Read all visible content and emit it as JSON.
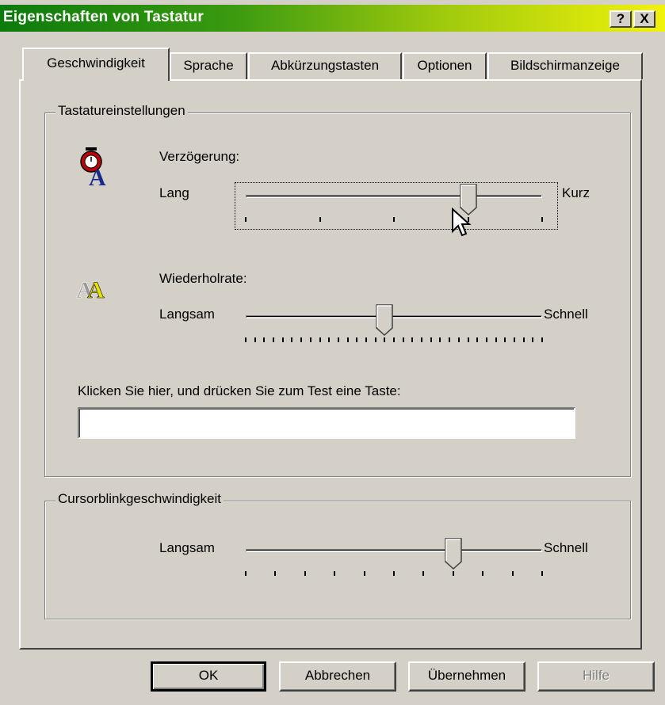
{
  "window": {
    "title": "Eigenschaften von Tastatur"
  },
  "title_buttons": {
    "help": "?",
    "close": "X"
  },
  "tabs": [
    {
      "label": "Geschwindigkeit",
      "active": true
    },
    {
      "label": "Sprache",
      "active": false
    },
    {
      "label": "Abkürzungstasten",
      "active": false
    },
    {
      "label": "Optionen",
      "active": false
    },
    {
      "label": "Bildschirmanzeige",
      "active": false
    }
  ],
  "keyboard_settings": {
    "legend": "Tastatureinstellungen",
    "delay": {
      "label": "Verzögerung:",
      "min_label": "Lang",
      "max_label": "Kurz",
      "value": 3,
      "max": 4,
      "tick_count": 5
    },
    "repeat": {
      "label": "Wiederholrate:",
      "min_label": "Langsam",
      "max_label": "Schnell",
      "value": 15,
      "max": 32,
      "tick_count": 33
    },
    "test_label": "Klicken Sie hier, und drücken Sie zum Test eine Taste:",
    "test_value": ""
  },
  "cursor_blink": {
    "legend": "Cursorblinkgeschwindigkeit",
    "min_label": "Langsam",
    "max_label": "Schnell",
    "value": 7,
    "max": 10,
    "tick_count": 11
  },
  "buttons": {
    "ok": "OK",
    "cancel": "Abbrechen",
    "apply": "Übernehmen",
    "help": "Hilfe"
  },
  "colors": {
    "face": "#d4d0c8",
    "title_start": "#0c7a0c",
    "title_end": "#f2f20a"
  }
}
